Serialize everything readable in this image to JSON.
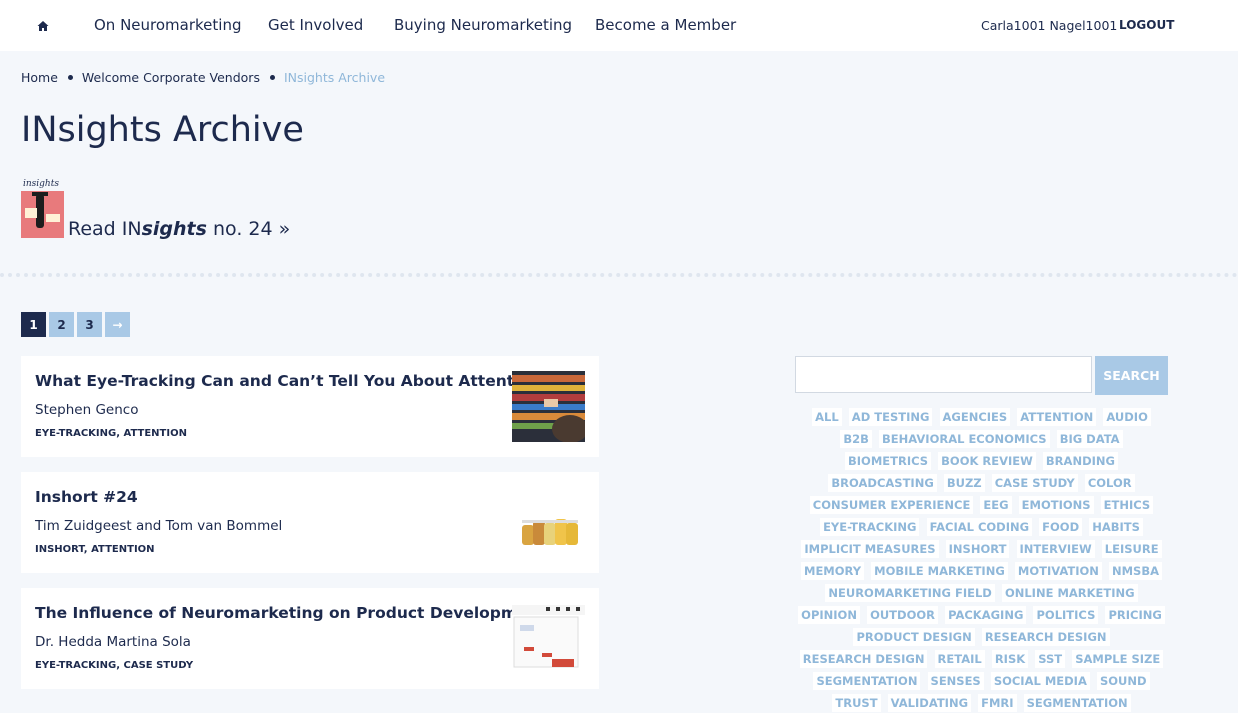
{
  "nav": {
    "items": [
      "On Neuromarketing",
      "Get Involved",
      "Buying Neuromarketing",
      "Become a Member"
    ],
    "user": "Carla1001 Nagel1001",
    "logout": "LOGOUT"
  },
  "breadcrumb": [
    "Home",
    "Welcome Corporate Vendors",
    "INsights Archive"
  ],
  "page": {
    "title": "INsights Archive"
  },
  "cover": {
    "label": "insights"
  },
  "read": {
    "prefix": "Read IN",
    "em": "sights",
    "suffix": " no. 24 »"
  },
  "pagination": [
    "1",
    "2",
    "3",
    "→"
  ],
  "posts": [
    {
      "title": "What Eye-Tracking Can and Can’t Tell You About Attention",
      "author": "Stephen Genco",
      "tags": "EYE-TRACKING, ATTENTION"
    },
    {
      "title": "Inshort #24",
      "author": "Tim Zuidgeest and Tom van Bommel",
      "tags": "INSHORT, ATTENTION"
    },
    {
      "title": "The Influence of Neuromarketing on Product Development",
      "author": "Dr. Hedda Martina Sola",
      "tags": "EYE-TRACKING, CASE STUDY"
    }
  ],
  "search": {
    "button": "SEARCH",
    "placeholder": ""
  },
  "tags": [
    "ALL",
    "AD TESTING",
    "AGENCIES",
    "ATTENTION",
    "AUDIO",
    "B2B",
    "BEHAVIORAL ECONOMICS",
    "BIG DATA",
    "BIOMETRICS",
    "BOOK REVIEW",
    "BRANDING",
    "BROADCASTING",
    "BUZZ",
    "CASE STUDY",
    "COLOR",
    "CONSUMER EXPERIENCE",
    "EEG",
    "EMOTIONS",
    "ETHICS",
    "EYE-TRACKING",
    "FACIAL CODING",
    "FOOD",
    "HABITS",
    "IMPLICIT MEASURES",
    "INSHORT",
    "INTERVIEW",
    "LEISURE",
    "MEMORY",
    "MOBILE MARKETING",
    "MOTIVATION",
    "NMSBA",
    "NEUROMARKETING FIELD",
    "ONLINE MARKETING",
    "OPINION",
    "OUTDOOR",
    "PACKAGING",
    "POLITICS",
    "PRICING",
    "PRODUCT DESIGN",
    "RESEARCH DESIGN",
    "RESEARCH DESIGN",
    "RETAIL",
    "RISK",
    "SST",
    "SAMPLE SIZE",
    "SEGMENTATION",
    "SENSES",
    "SOCIAL MEDIA",
    "SOUND",
    "TRUST",
    "VALIDATING",
    "FMRI",
    "SEGMENTATION"
  ]
}
